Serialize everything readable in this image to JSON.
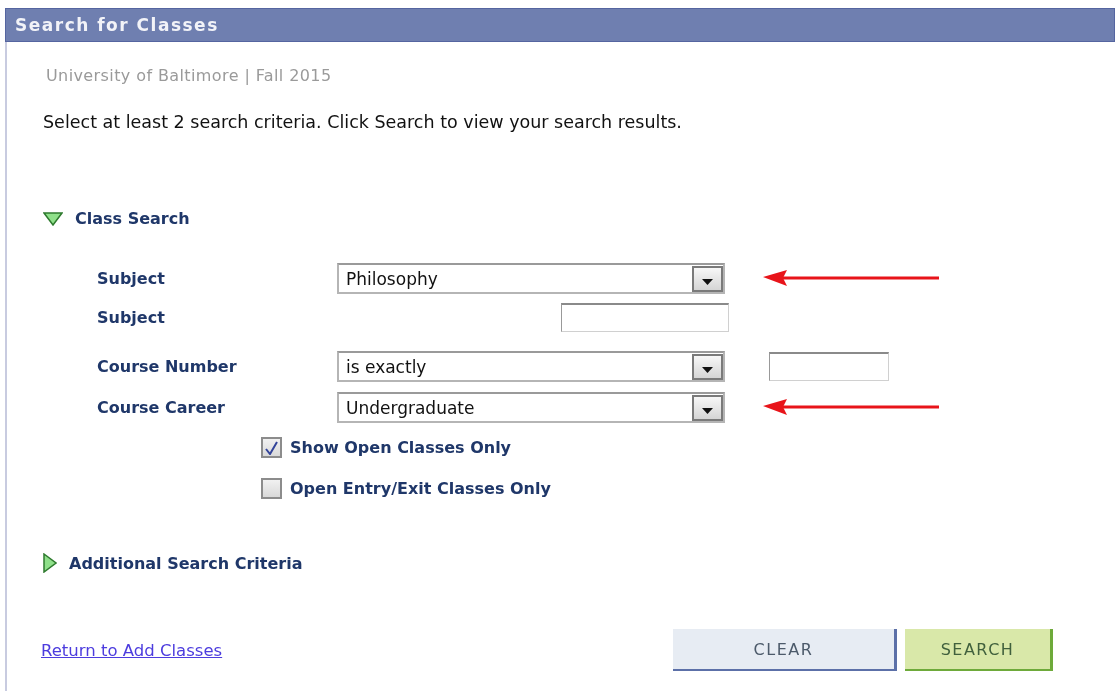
{
  "header": {
    "title": "Search for Classes"
  },
  "term": "University of Baltimore | Fall 2015",
  "instructions": "Select at least 2 search criteria. Click Search to view your search results.",
  "class_search": {
    "label": "Class Search",
    "expanded": true
  },
  "fields": [
    {
      "kind": "select",
      "label": "Subject",
      "value": "Philosophy",
      "marked": true
    },
    {
      "kind": "text",
      "label": "Subject"
    },
    {
      "kind": "select_text",
      "label": "Course Number",
      "value": "is exactly",
      "marked": false
    },
    {
      "kind": "select",
      "label": "Course Career",
      "value": "Undergraduate",
      "marked": true
    }
  ],
  "checkboxes": [
    {
      "label": "Show Open Classes Only",
      "checked": true
    },
    {
      "label": "Open Entry/Exit Classes Only",
      "checked": false
    }
  ],
  "additional": {
    "label": "Additional Search Criteria",
    "expanded": false
  },
  "link": "Return to Add Classes",
  "buttons": [
    {
      "kind": "clear",
      "label": "CLEAR"
    },
    {
      "kind": "search",
      "label": "SEARCH"
    }
  ]
}
